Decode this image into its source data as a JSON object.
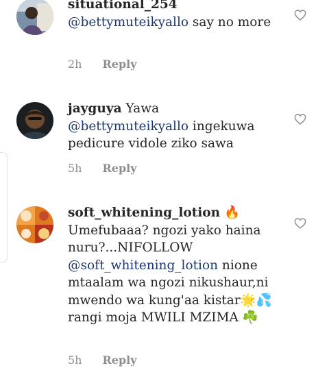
{
  "comments": [
    {
      "username": "situational_254",
      "text": "say no more",
      "mention": "@bettymuteikyallo",
      "time": "2h",
      "reply_label": "Reply"
    },
    {
      "username": "jayguya",
      "text_before": "Yawa",
      "mention": "@bettymuteikyallo",
      "text": "ingekuwa pedicure vidole ziko sawa",
      "time": "5h",
      "reply_label": "Reply"
    },
    {
      "username": "soft_whitening_lotion",
      "username_emoji": "🔥",
      "text_before": "Umefubaaa? ngozi yako haina nuru?...NIFOLLOW",
      "mention": "@soft_whitening_lotion",
      "text": "nione mtaalam wa ngozi nikushaur,ni mwendo wa kung'aa kistar🌟💦 rangi moja MWILI MZIMA ☘️",
      "time": "5h",
      "reply_label": "Reply"
    }
  ],
  "icons": {
    "like": "heart-outline-icon"
  },
  "colors": {
    "text": "#262626",
    "mention": "#1e3a6e",
    "meta": "#8e8e8e"
  }
}
